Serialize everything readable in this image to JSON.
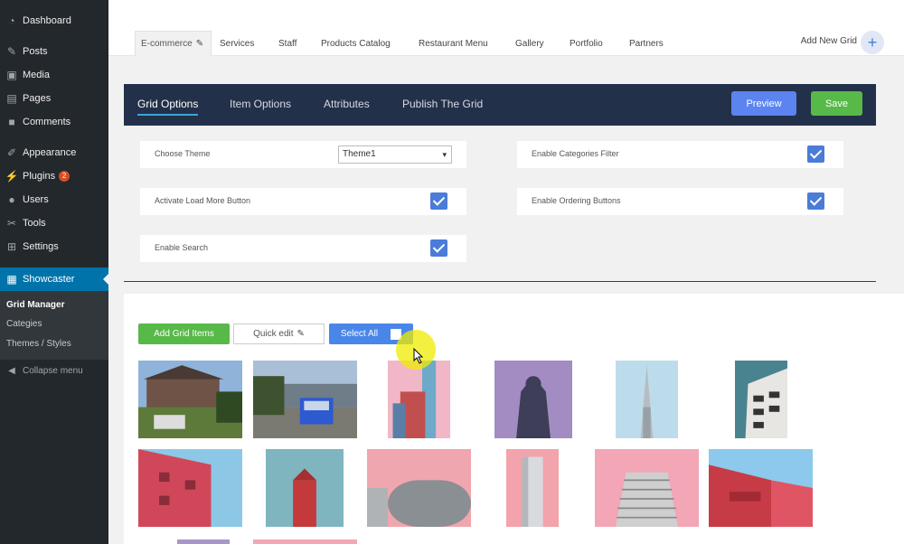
{
  "sidebar": {
    "items": [
      {
        "label": "Dashboard",
        "icon": "dashboard-icon"
      },
      {
        "label": "Posts",
        "icon": "pin-icon"
      },
      {
        "label": "Media",
        "icon": "media-icon"
      },
      {
        "label": "Pages",
        "icon": "pages-icon"
      },
      {
        "label": "Comments",
        "icon": "comment-icon"
      },
      {
        "label": "Appearance",
        "icon": "brush-icon"
      },
      {
        "label": "Plugins",
        "icon": "plugin-icon",
        "badge": "2"
      },
      {
        "label": "Users",
        "icon": "user-icon"
      },
      {
        "label": "Tools",
        "icon": "wrench-icon"
      },
      {
        "label": "Settings",
        "icon": "settings-icon"
      }
    ],
    "active": {
      "label": "Showcaster",
      "icon": "grid-icon"
    },
    "submenu": [
      "Grid Manager",
      "Categies",
      "Themes / Styles"
    ],
    "collapse": "Collapse menu"
  },
  "top_tabs": [
    "E-commerce",
    "Services",
    "Staff",
    "Products Catalog",
    "Restaurant Menu",
    "Gallery",
    "Portfolio",
    "Partners"
  ],
  "add_new_grid": "Add New Grid",
  "add_new_symbol": "+",
  "option_tabs": [
    "Grid Options",
    "Item Options",
    "Attributes",
    "Publish The Grid"
  ],
  "buttons": {
    "preview": "Preview",
    "save": "Save",
    "add_items": "Add Grid Items",
    "quick_edit": "Quick edit",
    "select_all": "Select All"
  },
  "options": {
    "choose_theme": {
      "label": "Choose Theme",
      "value": "Theme1"
    },
    "enable_categories": {
      "label": "Enable Categories Filter",
      "checked": true
    },
    "load_more": {
      "label": "Activate Load More Button",
      "checked": true
    },
    "ordering": {
      "label": "Enable Ordering Buttons",
      "checked": true
    },
    "search": {
      "label": "Enable Search",
      "checked": true
    }
  },
  "colors": {
    "sidebar": "#23282d",
    "accent": "#0073aa",
    "option_bar": "#23304a",
    "preview": "#5b84f0",
    "save": "#57b947",
    "checkbox": "#4a7cd8"
  },
  "thumbnails": [
    {
      "name": "house-photo-thumb",
      "kind": "house"
    },
    {
      "name": "car-photo-thumb",
      "kind": "car"
    },
    {
      "name": "building-pink-thumb",
      "kind": "pinkbldg"
    },
    {
      "name": "statue-thumb",
      "kind": "statue"
    },
    {
      "name": "tower-thumb",
      "kind": "tower"
    },
    {
      "name": "building-balcony-thumb",
      "kind": "balcony"
    },
    {
      "name": "red-wall-thumb",
      "kind": "redwall"
    },
    {
      "name": "red-tower-thumb",
      "kind": "redtower"
    },
    {
      "name": "round-building-thumb",
      "kind": "round"
    },
    {
      "name": "pillar-thumb",
      "kind": "pillar"
    },
    {
      "name": "stepped-building-thumb",
      "kind": "stepped"
    },
    {
      "name": "red-stairs-thumb",
      "kind": "redstairs"
    },
    {
      "name": "purple-thumb",
      "kind": "purple"
    },
    {
      "name": "pink-thumb",
      "kind": "pink"
    }
  ]
}
